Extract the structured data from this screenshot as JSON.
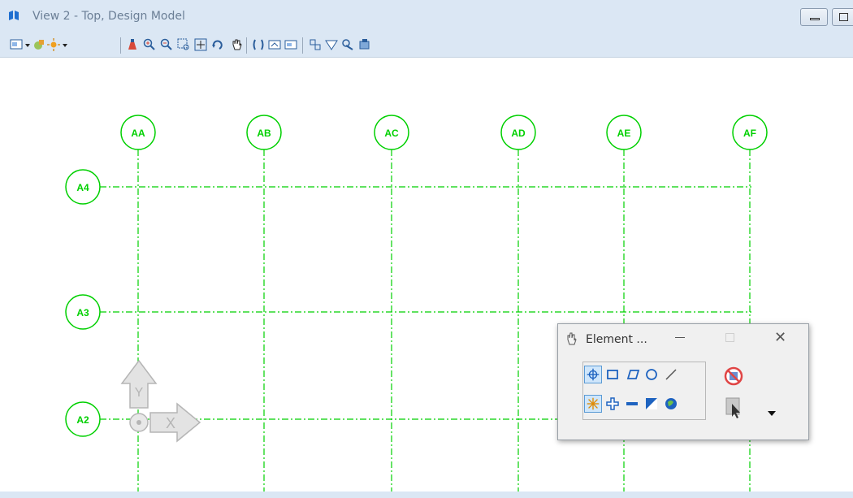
{
  "window": {
    "title": "View 2 - Top, Design Model",
    "buttons": [
      "minimize",
      "restore"
    ]
  },
  "toolbar": {
    "icons": [
      "view-attributes-icon",
      "dropdown-icon",
      "display-style-icon",
      "lighting-icon",
      "dropdown-icon",
      "update-view-icon",
      "zoom-in-icon",
      "zoom-out-icon",
      "window-area-icon",
      "fit-view-icon",
      "rotate-view-icon",
      "pan-view-icon",
      "view-previous-icon",
      "view-next-icon",
      "copy-view-icon",
      "standard-views-icon",
      "clip-volume-icon",
      "clip-mask-icon",
      "camera-icon"
    ]
  },
  "grid": {
    "columns": [
      "AA",
      "AB",
      "AC",
      "AD",
      "AE",
      "AF"
    ],
    "rows": [
      "A4",
      "A3",
      "A2"
    ],
    "color": "#00d000"
  },
  "view_axes": {
    "x_label": "X",
    "y_label": "Y"
  },
  "element_dialog": {
    "title": "Element ...",
    "row1_tools": [
      "element-selection-icon",
      "rectangle-select-icon",
      "shape-select-icon",
      "circle-select-icon",
      "line-select-icon"
    ],
    "row2_tools": [
      "individual-mode-icon",
      "add-mode-icon",
      "subtract-mode-icon",
      "invert-mode-icon",
      "select-all-icon"
    ],
    "side_tools": [
      "clear-selection-icon",
      "select-pointer-icon",
      "more-options-arrow-icon"
    ]
  }
}
